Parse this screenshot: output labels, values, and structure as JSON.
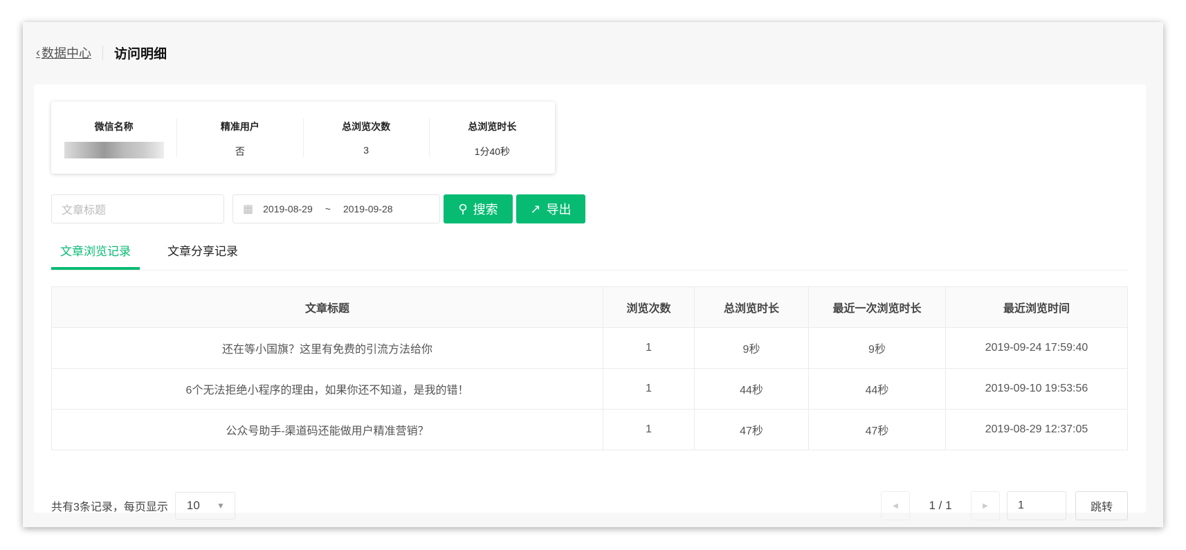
{
  "header": {
    "back_label": "数据中心",
    "title": "访问明细"
  },
  "info": [
    {
      "label": "微信名称",
      "value": ""
    },
    {
      "label": "精准用户",
      "value": "否"
    },
    {
      "label": "总浏览次数",
      "value": "3"
    },
    {
      "label": "总浏览时长",
      "value": "1分40秒"
    }
  ],
  "filters": {
    "title_placeholder": "文章标题",
    "date_start": "2019-08-29",
    "date_sep": "~",
    "date_end": "2019-09-28",
    "search_label": "搜索",
    "export_label": "导出"
  },
  "tabs": [
    {
      "label": "文章浏览记录",
      "active": true
    },
    {
      "label": "文章分享记录",
      "active": false
    }
  ],
  "table": {
    "headers": [
      "文章标题",
      "浏览次数",
      "总浏览时长",
      "最近一次浏览时长",
      "最近浏览时间"
    ],
    "rows": [
      [
        "还在等小国旗？这里有免费的引流方法给你",
        "1",
        "9秒",
        "9秒",
        "2019-09-24 17:59:40"
      ],
      [
        "6个无法拒绝小程序的理由，如果你还不知道，是我的错！",
        "1",
        "44秒",
        "44秒",
        "2019-09-10 19:53:56"
      ],
      [
        "公众号助手-渠道码还能做用户精准营销？",
        "1",
        "47秒",
        "47秒",
        "2019-08-29 12:37:05"
      ]
    ]
  },
  "footer": {
    "summary": "共有3条记录，每页显示",
    "page_size": "10",
    "page_text": "1 / 1",
    "page_input": "1",
    "jump_label": "跳转"
  },
  "colors": {
    "accent": "#07bb73"
  }
}
